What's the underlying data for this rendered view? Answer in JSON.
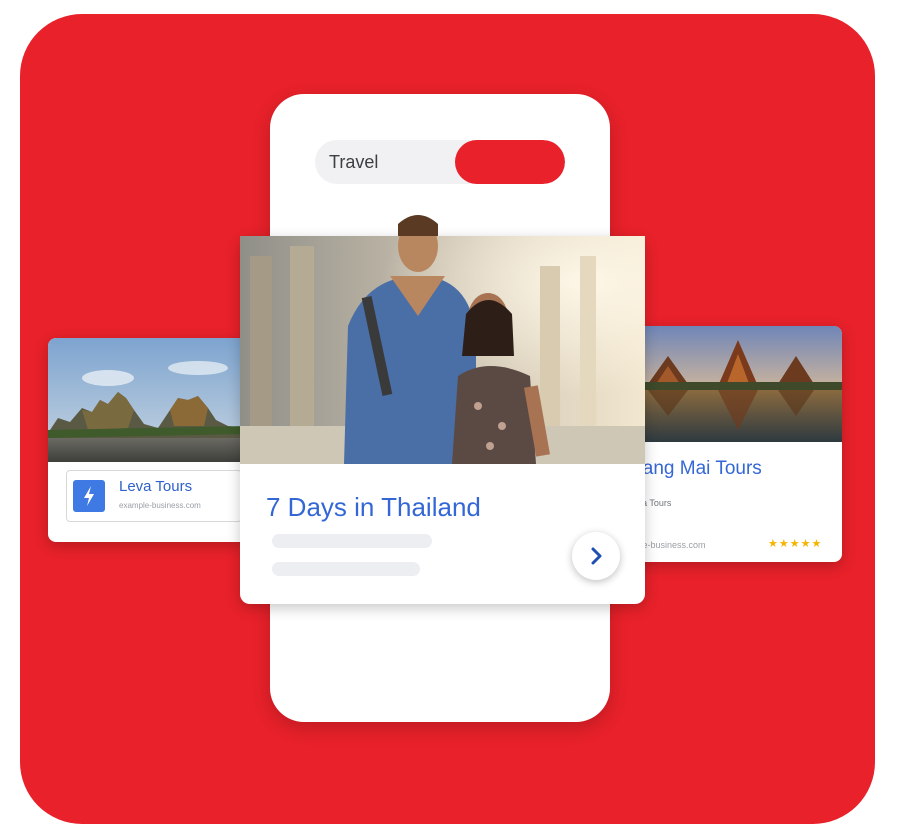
{
  "search": {
    "query": "Travel"
  },
  "left_card": {
    "brand_name": "Leva Tours",
    "url": "example-business.com",
    "logo_icon": "lightning-bolt-icon"
  },
  "main_card": {
    "title": "7 Days in Thailand",
    "next_icon": "chevron-right-icon"
  },
  "right_card": {
    "title": "hiang Mai Tours",
    "subtitle": "a Tours",
    "url": "mple-business.com",
    "stars": "★★★★★"
  },
  "colors": {
    "brand_red": "#e8212a",
    "link_blue": "#3467d6",
    "logo_blue": "#3f79e4",
    "star_yellow": "#f4b400"
  }
}
